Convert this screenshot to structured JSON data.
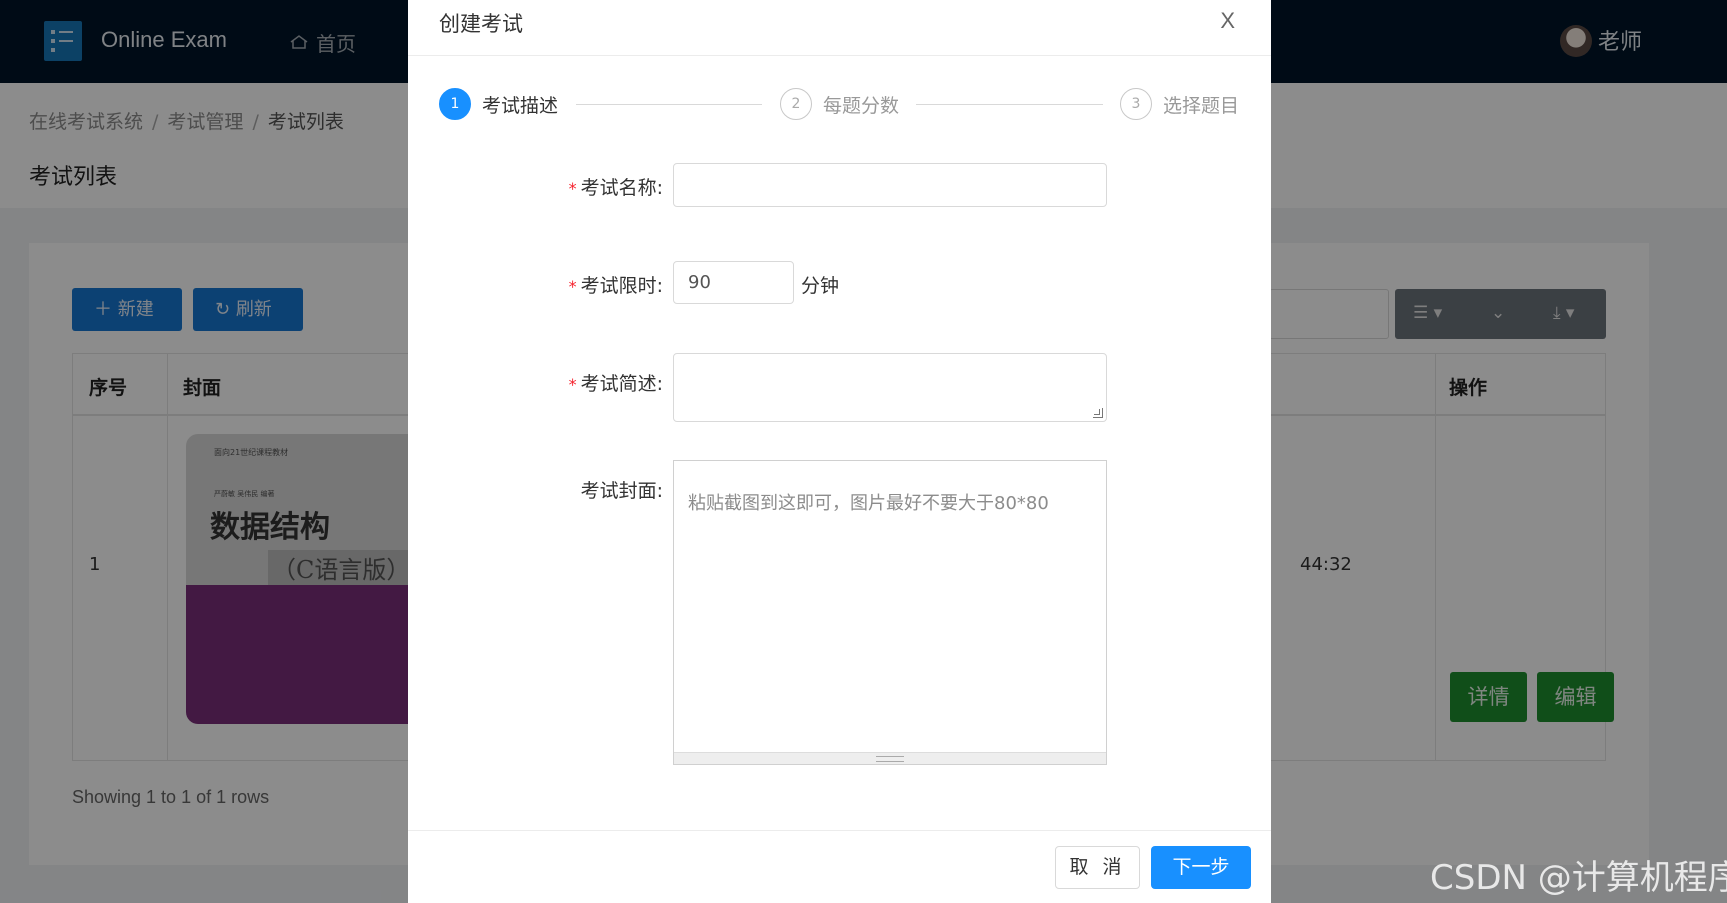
{
  "app": {
    "title": "Online Exam",
    "nav_home": "首页",
    "user_name": "老师"
  },
  "breadcrumb": {
    "items": [
      "在线考试系统",
      "考试管理",
      "考试列表"
    ],
    "separator": "/"
  },
  "page": {
    "title": "考试列表"
  },
  "toolbar": {
    "new_label": "新建",
    "refresh_label": "刷新"
  },
  "table": {
    "headers": {
      "index": "序号",
      "cover": "封面",
      "actions": "操作"
    },
    "rows": [
      {
        "index": "1",
        "cover_text_top": "面向21世纪课程教材",
        "cover_authors": "严蔚敏 吴伟民 编著",
        "cover_title": "数据结构",
        "cover_subtitle": "（C语言版）",
        "time_fragment": "44:32",
        "detail_label": "详情",
        "edit_label": "编辑"
      }
    ],
    "footer": "Showing 1 to 1 of 1 rows"
  },
  "modal": {
    "title": "创建考试",
    "close_label": "X",
    "steps": [
      {
        "number": "1",
        "label": "考试描述",
        "state": "active"
      },
      {
        "number": "2",
        "label": "每题分数",
        "state": "pending"
      },
      {
        "number": "3",
        "label": "选择题目",
        "state": "pending"
      }
    ],
    "form": {
      "name_label": "考试名称:",
      "name_value": "",
      "time_label": "考试限时:",
      "time_value": "90",
      "time_unit": "分钟",
      "desc_label": "考试简述:",
      "desc_value": "",
      "cover_label": "考试封面:",
      "cover_placeholder": "粘贴截图到这即可，图片最好不要大于80*80",
      "required_mark": "*"
    },
    "footer": {
      "cancel_label": "取 消",
      "next_label": "下一步"
    }
  },
  "watermark": "CSDN @计算机程序",
  "colors": {
    "topbar": "#001529",
    "primary": "#1890ff",
    "success": "#1e8f2f",
    "required": "#f5222d"
  }
}
